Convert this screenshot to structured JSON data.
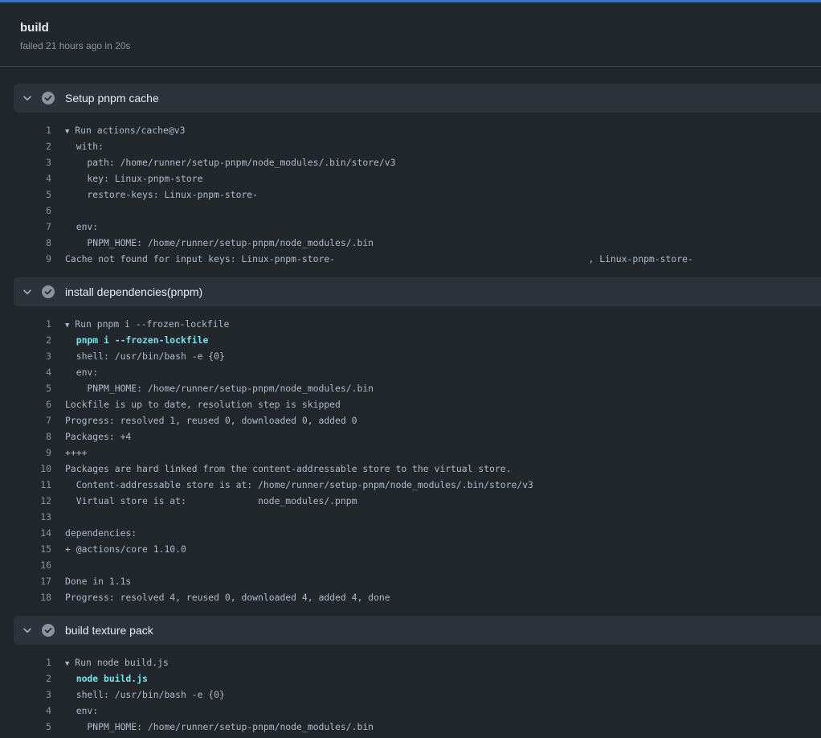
{
  "job": {
    "title": "build",
    "status": "failed 21 hours ago in 20s"
  },
  "colors": {
    "accent": "#3a6fc4",
    "command": "#76e3ea",
    "success_check": "#8b949e"
  },
  "steps": [
    {
      "title": "Setup pnpm cache",
      "icon": "check-circle-icon",
      "lines": [
        {
          "n": "1",
          "t": "▾ Run actions/cache@v3"
        },
        {
          "n": "2",
          "t": "  with:"
        },
        {
          "n": "3",
          "t": "    path: /home/runner/setup-pnpm/node_modules/.bin/store/v3"
        },
        {
          "n": "4",
          "t": "    key: Linux-pnpm-store"
        },
        {
          "n": "5",
          "t": "    restore-keys: Linux-pnpm-store-"
        },
        {
          "n": "6",
          "t": ""
        },
        {
          "n": "7",
          "t": "  env:"
        },
        {
          "n": "8",
          "t": "    PNPM_HOME: /home/runner/setup-pnpm/node_modules/.bin"
        },
        {
          "n": "9",
          "t": "Cache not found for input keys: Linux-pnpm-store-                                              , Linux-pnpm-store-"
        }
      ]
    },
    {
      "title": "install dependencies(pnpm)",
      "icon": "check-circle-icon",
      "lines": [
        {
          "n": "1",
          "t": "▾ Run pnpm i --frozen-lockfile"
        },
        {
          "n": "2",
          "t": "  pnpm i --frozen-lockfile",
          "cmd": true
        },
        {
          "n": "3",
          "t": "  shell: /usr/bin/bash -e {0}"
        },
        {
          "n": "4",
          "t": "  env:"
        },
        {
          "n": "5",
          "t": "    PNPM_HOME: /home/runner/setup-pnpm/node_modules/.bin"
        },
        {
          "n": "6",
          "t": "Lockfile is up to date, resolution step is skipped"
        },
        {
          "n": "7",
          "t": "Progress: resolved 1, reused 0, downloaded 0, added 0"
        },
        {
          "n": "8",
          "t": "Packages: +4"
        },
        {
          "n": "9",
          "t": "++++"
        },
        {
          "n": "10",
          "t": "Packages are hard linked from the content-addressable store to the virtual store."
        },
        {
          "n": "11",
          "t": "  Content-addressable store is at: /home/runner/setup-pnpm/node_modules/.bin/store/v3"
        },
        {
          "n": "12",
          "t": "  Virtual store is at:             node_modules/.pnpm"
        },
        {
          "n": "13",
          "t": ""
        },
        {
          "n": "14",
          "t": "dependencies:"
        },
        {
          "n": "15",
          "t": "+ @actions/core 1.10.0"
        },
        {
          "n": "16",
          "t": ""
        },
        {
          "n": "17",
          "t": "Done in 1.1s"
        },
        {
          "n": "18",
          "t": "Progress: resolved 4, reused 0, downloaded 4, added 4, done"
        }
      ]
    },
    {
      "title": "build texture pack",
      "icon": "check-circle-icon",
      "lines": [
        {
          "n": "1",
          "t": "▾ Run node build.js"
        },
        {
          "n": "2",
          "t": "  node build.js",
          "cmd": true
        },
        {
          "n": "3",
          "t": "  shell: /usr/bin/bash -e {0}"
        },
        {
          "n": "4",
          "t": "  env:"
        },
        {
          "n": "5",
          "t": "    PNPM_HOME: /home/runner/setup-pnpm/node_modules/.bin"
        }
      ]
    }
  ]
}
